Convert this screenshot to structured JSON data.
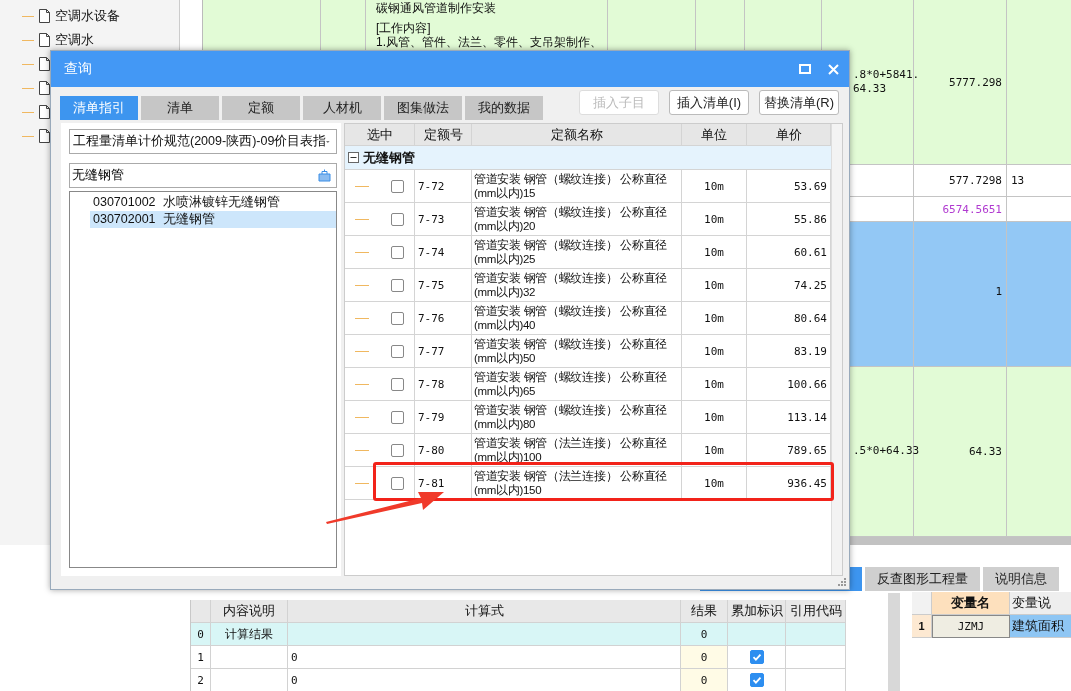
{
  "tree": {
    "items": [
      {
        "kind": "document",
        "label": "空调水设备"
      },
      {
        "kind": "document",
        "label": "空调水"
      },
      {
        "kind": "covered"
      },
      {
        "kind": "covered"
      },
      {
        "kind": "covered"
      },
      {
        "kind": "covered"
      }
    ]
  },
  "main_grid": {
    "rows": [
      {
        "kind": "item",
        "description": [
          "碳钢通风管道制作安装",
          "[工作内容]",
          "1.风管、管件、法兰、零件、支吊架制作、"
        ],
        "formula": [
          ".8*0+5841.",
          "64.33"
        ],
        "quantity": "5777.298"
      },
      {
        "kind": "plain",
        "quantity": "577.7298",
        "column_9": "13"
      },
      {
        "kind": "subtotal",
        "quantity": "6574.5651"
      },
      {
        "kind": "selected",
        "quantity": "1"
      },
      {
        "kind": "item",
        "formula": [
          ".5*0+64.33"
        ],
        "quantity": "64.33"
      }
    ]
  },
  "bottom_tabs": [
    {
      "label": "反查图形工程量",
      "selected": false
    },
    {
      "label": "说明信息",
      "selected": false
    }
  ],
  "calc_table": {
    "columns": [
      "内容说明",
      "计算式",
      "结果",
      "累加标识",
      "引用代码"
    ],
    "rows": [
      {
        "index": "0",
        "kind": "total",
        "description": "计算结果",
        "result": "0"
      },
      {
        "index": "1",
        "kind": "line",
        "formula": "0",
        "result": "0",
        "accumulate": true
      },
      {
        "index": "2",
        "kind": "line",
        "formula": "0",
        "result": "0",
        "accumulate": true
      }
    ]
  },
  "variables": {
    "columns": [
      "变量名",
      "变量说"
    ],
    "rows": [
      {
        "index": "1",
        "name": "JZMJ",
        "description": "建筑面积"
      }
    ]
  },
  "dialog": {
    "title": "查询",
    "tabs": [
      {
        "label": "清单指引",
        "selected": true
      },
      {
        "label": "清单",
        "selected": false
      },
      {
        "label": "定额",
        "selected": false
      },
      {
        "label": "人材机",
        "selected": false
      },
      {
        "label": "图集做法",
        "selected": false
      },
      {
        "label": "我的数据",
        "selected": false
      }
    ],
    "buttons": [
      {
        "label": "插入子目",
        "disabled": true
      },
      {
        "label": "插入清单(I)",
        "disabled": false
      },
      {
        "label": "替换清单(R)",
        "disabled": false
      }
    ],
    "standard": "工程量清单计价规范(2009-陕西)-09价目表指",
    "search": {
      "value": "无缝钢管"
    },
    "results": [
      {
        "code": "030701002",
        "name": "水喷淋镀锌无缝钢管",
        "selected": false
      },
      {
        "code": "030702001",
        "name": "无缝钢管",
        "selected": true
      }
    ],
    "grid": {
      "columns": [
        "选中",
        "定额号",
        "定额名称",
        "单位",
        "单价"
      ],
      "group": {
        "label": "无缝钢管",
        "expanded": true
      },
      "rows": [
        {
          "checked": false,
          "code": "7-72",
          "name": "管道安装 钢管（螺纹连接） 公称直径(mm以内)15",
          "unit": "10m",
          "price": "53.69",
          "highlighted": false
        },
        {
          "checked": false,
          "code": "7-73",
          "name": "管道安装 钢管（螺纹连接） 公称直径(mm以内)20",
          "unit": "10m",
          "price": "55.86",
          "highlighted": false
        },
        {
          "checked": false,
          "code": "7-74",
          "name": "管道安装 钢管（螺纹连接） 公称直径(mm以内)25",
          "unit": "10m",
          "price": "60.61",
          "highlighted": false
        },
        {
          "checked": false,
          "code": "7-75",
          "name": "管道安装 钢管（螺纹连接） 公称直径(mm以内)32",
          "unit": "10m",
          "price": "74.25",
          "highlighted": false
        },
        {
          "checked": false,
          "code": "7-76",
          "name": "管道安装 钢管（螺纹连接） 公称直径(mm以内)40",
          "unit": "10m",
          "price": "80.64",
          "highlighted": false
        },
        {
          "checked": false,
          "code": "7-77",
          "name": "管道安装 钢管（螺纹连接） 公称直径(mm以内)50",
          "unit": "10m",
          "price": "83.19",
          "highlighted": false
        },
        {
          "checked": false,
          "code": "7-78",
          "name": "管道安装 钢管（螺纹连接） 公称直径(mm以内)65",
          "unit": "10m",
          "price": "100.66",
          "highlighted": false
        },
        {
          "checked": false,
          "code": "7-79",
          "name": "管道安装 钢管（螺纹连接） 公称直径(mm以内)80",
          "unit": "10m",
          "price": "113.14",
          "highlighted": false
        },
        {
          "checked": false,
          "code": "7-80",
          "name": "管道安装 钢管（法兰连接） 公称直径(mm以内)100",
          "unit": "10m",
          "price": "789.65",
          "highlighted": false
        },
        {
          "checked": false,
          "code": "7-81",
          "name": "管道安装 钢管（法兰连接） 公称直径(mm以内)150",
          "unit": "10m",
          "price": "936.45",
          "highlighted": true
        }
      ]
    }
  }
}
